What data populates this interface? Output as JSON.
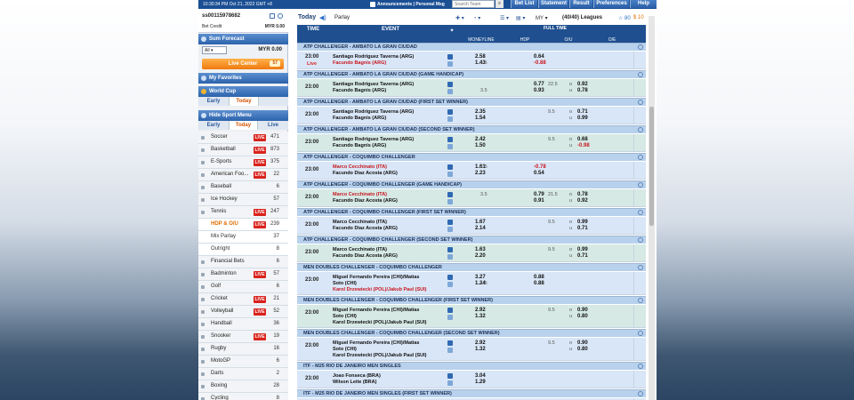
{
  "topbar": {
    "clock": "10:30:34 PM Oct 21, 2022 GMT +8",
    "announcements": "Announcements | Personal Msg",
    "search_placeholder": "Search Team",
    "buttons": [
      "Bet List",
      "Statement",
      "Result",
      "Preferences",
      "Help"
    ]
  },
  "account": {
    "id": "ss00115978682",
    "bet_credit_label": "Bet Credit",
    "bet_credit_value": "MYR 0.00"
  },
  "sum_forecast": {
    "title": "Sum Forecast",
    "select": "All",
    "value": "MYR 0.00"
  },
  "live_center": {
    "label": "Live Center",
    "badge": "57"
  },
  "favorites": {
    "title": "My Favorites"
  },
  "world_cup": {
    "title": "World Cup",
    "tabs": [
      "Early",
      "Today"
    ]
  },
  "sport_menu": {
    "title": "Hide Sport Menu",
    "tabs": [
      "Early",
      "Today",
      "Live"
    ]
  },
  "sports": [
    {
      "name": "Soccer",
      "live": "LIVE",
      "count": "471"
    },
    {
      "name": "Basketball",
      "live": "LIVE",
      "count": "873"
    },
    {
      "name": "E-Sports",
      "live": "LIVE",
      "count": "375"
    },
    {
      "name": "American Foo...",
      "live": "LIVE",
      "count": "22"
    },
    {
      "name": "Baseball",
      "live": "",
      "count": "6"
    },
    {
      "name": "Ice Hockey",
      "live": "",
      "count": "57"
    },
    {
      "name": "Tennis",
      "live": "LIVE",
      "count": "247"
    },
    {
      "name": "HDP & O/U",
      "live": "LIVE",
      "count": "239",
      "sub": true,
      "on": true
    },
    {
      "name": "Mix Parlay",
      "live": "",
      "count": "37",
      "sub": true
    },
    {
      "name": "Outright",
      "live": "",
      "count": "8",
      "sub": true
    },
    {
      "name": "Financial Bets",
      "live": "",
      "count": "6"
    },
    {
      "name": "Badminton",
      "live": "LIVE",
      "count": "57"
    },
    {
      "name": "Golf",
      "live": "",
      "count": "6"
    },
    {
      "name": "Cricket",
      "live": "LIVE",
      "count": "21"
    },
    {
      "name": "Volleyball",
      "live": "LIVE",
      "count": "52"
    },
    {
      "name": "Handball",
      "live": "",
      "count": "36"
    },
    {
      "name": "Snooker",
      "live": "LIVE",
      "count": "19"
    },
    {
      "name": "Rugby",
      "live": "",
      "count": "16"
    },
    {
      "name": "MotoGP",
      "live": "",
      "count": "6"
    },
    {
      "name": "Darts",
      "live": "",
      "count": "2"
    },
    {
      "name": "Boxing",
      "live": "",
      "count": "28"
    },
    {
      "name": "Cycling",
      "live": "",
      "count": "8"
    }
  ],
  "toolbar": {
    "today": "Today",
    "parlay": "Parlay",
    "odds_type": "MY",
    "leagues": "(40/40) Leagues",
    "fav": "80",
    "dollar": "10"
  },
  "table_header": {
    "time": "TIME",
    "event": "EVENT",
    "full_time": "FULL TIME",
    "cols": [
      "MONEYLINE",
      "HDP",
      "O/U",
      "O/E"
    ]
  },
  "leagues": [
    {
      "name": "ATP CHALLENGER - AMBATO LA GRAN CIUDAD",
      "rows": [
        {
          "time": "23:00",
          "live": "Live",
          "home": "Santiago Rodriguez Taverna (ARG)",
          "away": "Facundo Bagnis (ARG)",
          "away_red": true,
          "ml1": "2.58",
          "ml2": "1.43",
          "hdp_line2": "1.5",
          "hdp1": "0.64",
          "hdp2": "-0.88",
          "hdp2_red": true
        }
      ]
    },
    {
      "name": "ATP CHALLENGER - AMBATO LA GRAN CIUDAD (GAME HANDICAP)",
      "rows": [
        {
          "time": "23:00",
          "home": "Santiago Rodriguez Taverna (ARG)",
          "away": "Facundo Bagnis (ARG)",
          "hdp_line2": "3.5",
          "hdp1": "0.77",
          "hdp2": "0.93",
          "ou_line": "22.5",
          "ou_o": "o",
          "ou_u": "u",
          "ou1": "0.92",
          "ou2": "0.78"
        }
      ]
    },
    {
      "name": "ATP CHALLENGER - AMBATO LA GRAN CIUDAD (FIRST SET WINNER)",
      "rows": [
        {
          "time": "23:00",
          "home": "Santiago Rodriguez Taverna (ARG)",
          "away": "Facundo Bagnis (ARG)",
          "ml1": "2.35",
          "ml2": "1.54",
          "ou_line": "9.5",
          "ou_o": "o",
          "ou_u": "u",
          "ou1": "0.71",
          "ou2": "0.99"
        }
      ]
    },
    {
      "name": "ATP CHALLENGER - AMBATO LA GRAN CIUDAD (SECOND SET WINNER)",
      "rows": [
        {
          "time": "23:00",
          "home": "Santiago Rodriguez Taverna (ARG)",
          "away": "Facundo Bagnis (ARG)",
          "ml1": "2.42",
          "ml2": "1.50",
          "ou_line": "9.5",
          "ou_o": "o",
          "ou_u": "u",
          "ou1": "0.68",
          "ou2": "-0.98",
          "ou2_red": true
        }
      ]
    },
    {
      "name": "ATP CHALLENGER - COQUIMBO CHALLENGER",
      "rows": [
        {
          "time": "23:00",
          "home": "Marco Cecchinato (ITA)",
          "home_red": true,
          "away": "Facundo Diaz Acosta (ARG)",
          "ml1": "1.61",
          "ml2": "2.23",
          "hdp_line1": "1.5",
          "hdp1": "-0.78",
          "hdp1_red": true,
          "hdp2": "0.54"
        }
      ]
    },
    {
      "name": "ATP CHALLENGER - COQUIMBO CHALLENGER (GAME HANDICAP)",
      "rows": [
        {
          "time": "23:00",
          "home": "Marco Cecchinato (ITA)",
          "home_red": true,
          "away": "Facundo Diaz Acosta (ARG)",
          "hdp_line1": "3.5",
          "hdp1": "0.79",
          "hdp2": "0.91",
          "ou_line": "21.5",
          "ou_o": "o",
          "ou_u": "u",
          "ou1": "0.78",
          "ou2": "0.92"
        }
      ]
    },
    {
      "name": "ATP CHALLENGER - COQUIMBO CHALLENGER (FIRST SET WINNER)",
      "rows": [
        {
          "time": "23:00",
          "home": "Marco Cecchinato (ITA)",
          "away": "Facundo Diaz Acosta (ARG)",
          "ml1": "1.67",
          "ml2": "2.14",
          "ou_line": "9.5",
          "ou_o": "o",
          "ou_u": "u",
          "ou1": "0.99",
          "ou2": "0.71"
        }
      ]
    },
    {
      "name": "ATP CHALLENGER - COQUIMBO CHALLENGER (SECOND SET WINNER)",
      "rows": [
        {
          "time": "23:00",
          "home": "Marco Cecchinato (ITA)",
          "away": "Facundo Diaz Acosta (ARG)",
          "ml1": "1.63",
          "ml2": "2.20",
          "ou_line": "9.5",
          "ou_o": "o",
          "ou_u": "u",
          "ou1": "0.99",
          "ou2": "0.71"
        }
      ]
    },
    {
      "name": "MEN DOUBLES CHALLENGER - COQUIMBO CHALLENGER",
      "rows": [
        {
          "time": "23:00",
          "home": "Miguel Fernando Pereira (CHI)/Matias",
          "home2": "Soto (CHI)",
          "away": "Karol Drzewiecki (POL)/Jakub Paul (SUI)",
          "away_red": true,
          "ml1": "3.27",
          "ml2": "1.24",
          "hdp_line2": "1.5",
          "hdp1": "0.88",
          "hdp2": "0.88"
        }
      ]
    },
    {
      "name": "MEN DOUBLES CHALLENGER - COQUIMBO CHALLENGER (FIRST SET WINNER)",
      "rows": [
        {
          "time": "23:00",
          "home": "Miguel Fernando Pereira (CHI)/Matias",
          "home2": "Soto (CHI)",
          "away": "Karol Drzewiecki (POL)/Jakub Paul (SUI)",
          "ml1": "2.92",
          "ml2": "1.32",
          "ou_line": "9.5",
          "ou_o": "o",
          "ou_u": "u",
          "ou1": "0.90",
          "ou2": "0.80"
        }
      ]
    },
    {
      "name": "MEN DOUBLES CHALLENGER - COQUIMBO CHALLENGER (SECOND SET WINNER)",
      "rows": [
        {
          "time": "23:00",
          "home": "Miguel Fernando Pereira (CHI)/Matias",
          "home2": "Soto (CHI)",
          "away": "Karol Drzewiecki (POL)/Jakub Paul (SUI)",
          "ml1": "2.92",
          "ml2": "1.32",
          "ou_line": "9.5",
          "ou_o": "o",
          "ou_u": "u",
          "ou1": "0.90",
          "ou2": "0.80"
        }
      ]
    },
    {
      "name": "ITF - M25 RIO DE JANEIRO MEN SINGLES",
      "rows": [
        {
          "time": "23:00",
          "home": "Joao Fonseca (BRA)",
          "away": "Wilson Leite (BRA)",
          "ml1": "3.04",
          "ml2": "1.29"
        }
      ]
    },
    {
      "name": "ITF - M25 RIO DE JANEIRO MEN SINGLES (FIRST SET WINNER)",
      "rows": [
        {
          "time": "23:00",
          "home": "Joao Fonseca (BRA)",
          "away": "Wilson Leite (BRA)",
          "ml1": "2.69",
          "ml2": "1.39"
        }
      ]
    }
  ],
  "colors": {
    "header_blue": "#1f4f8f",
    "league_bar": "#b8d1ec",
    "row_blue": "#d9e6f7",
    "row_green": "#d6e9e4",
    "live_red": "#d9231d",
    "accent_orange": "#f07a10"
  }
}
